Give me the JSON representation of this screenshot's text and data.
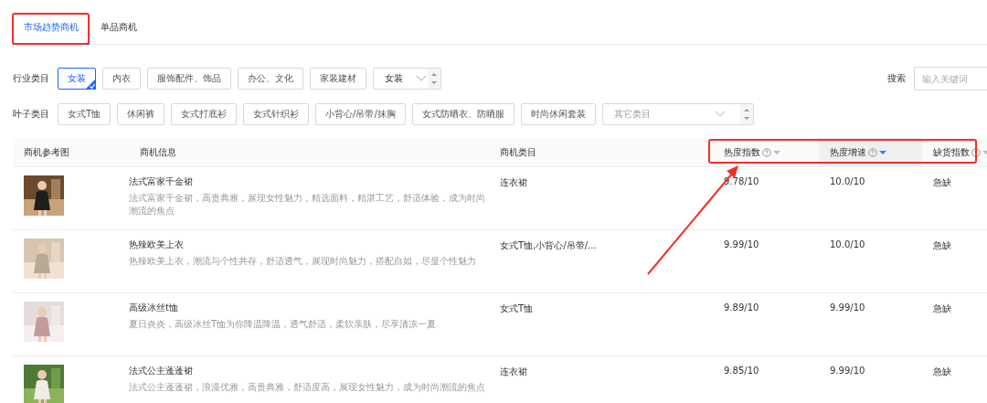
{
  "tabs": [
    {
      "label": "市场趋势商机",
      "selected": true
    },
    {
      "label": "单品商机",
      "selected": false
    }
  ],
  "industry": {
    "label": "行业类目",
    "chips": [
      {
        "label": "女装",
        "selected": true
      },
      {
        "label": "内衣",
        "selected": false
      },
      {
        "label": "服饰配件、饰品",
        "selected": false
      },
      {
        "label": "办公、文化",
        "selected": false
      },
      {
        "label": "家装建材",
        "selected": false
      }
    ],
    "select": {
      "value": "女装"
    }
  },
  "search": {
    "label": "搜索",
    "placeholder": "输入关键词"
  },
  "leaf": {
    "label": "叶子类目",
    "chips": [
      {
        "label": "女式T恤",
        "selected": false
      },
      {
        "label": "休闲裤",
        "selected": false
      },
      {
        "label": "女式打底衫",
        "selected": false
      },
      {
        "label": "女式针织衫",
        "selected": false
      },
      {
        "label": "小背心/吊带/抹胸",
        "selected": false
      },
      {
        "label": "女式防晒衣、防晒服",
        "selected": false
      },
      {
        "label": "时尚休闲套装",
        "selected": false
      }
    ],
    "select": {
      "placeholder": "其它类目"
    }
  },
  "table": {
    "columns": [
      {
        "label": "商机参考图",
        "sortable": false
      },
      {
        "label": "商机信息",
        "sortable": false
      },
      {
        "label": "商机类目",
        "sortable": false
      },
      {
        "label": "热度指数",
        "sortable": true,
        "sorted": false
      },
      {
        "label": "热度增速",
        "sortable": true,
        "sorted": true
      },
      {
        "label": "缺货指数",
        "sortable": true,
        "sorted": false
      }
    ],
    "rows": [
      {
        "title": "法式富家千金裙",
        "description": "法式富家千金裙，高贵典雅，展现女性魅力，精选面料，精湛工艺，舒适体验，成为时尚潮流的焦点",
        "category": "连衣裙",
        "heat_index": "9.78/10",
        "heat_growth": "10.0/10",
        "shortage": "急缺"
      },
      {
        "title": "热辣欧美上衣",
        "description": "热辣欧美上衣，潮流与个性共存，舒适透气，展现时尚魅力，搭配自如，尽显个性魅力",
        "category": "女式T恤,小背心/吊带/...",
        "heat_index": "9.99/10",
        "heat_growth": "10.0/10",
        "shortage": "急缺"
      },
      {
        "title": "高级冰丝t恤",
        "description": "夏日炎炎，高级冰丝T恤为你降温降温，透气舒适，柔软亲肤，尽享清凉一夏",
        "category": "女式T恤",
        "heat_index": "9.89/10",
        "heat_growth": "9.99/10",
        "shortage": "急缺"
      },
      {
        "title": "法式公主蓬蓬裙",
        "description": "法式公主蓬蓬裙，浪漫优雅，高贵典雅，舒适度高，展现女性魅力，成为时尚潮流的焦点",
        "category": "连衣裙",
        "heat_index": "9.85/10",
        "heat_growth": "9.99/10",
        "shortage": "急缺"
      }
    ]
  }
}
